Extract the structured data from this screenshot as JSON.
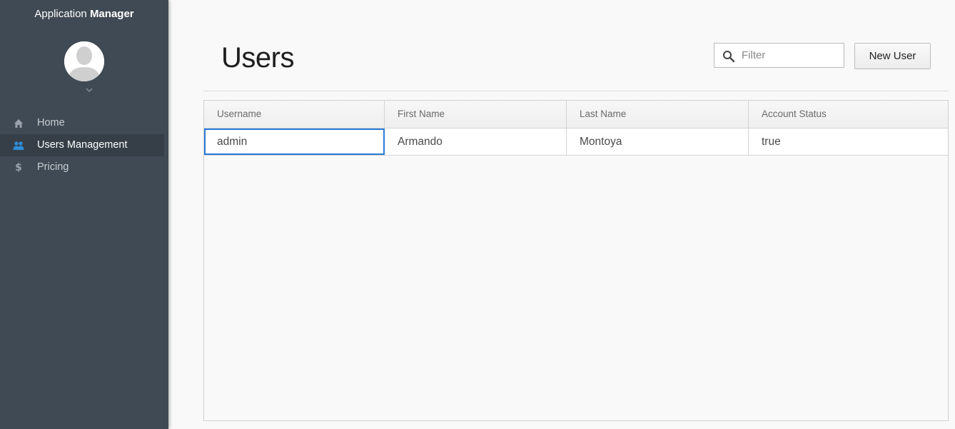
{
  "app": {
    "title_regular": "Application ",
    "title_bold": "Manager"
  },
  "sidebar": {
    "items": [
      {
        "label": "Home",
        "icon": "home-icon",
        "active": false
      },
      {
        "label": "Users Management",
        "icon": "users-icon",
        "active": true
      },
      {
        "label": "Pricing",
        "icon": "dollar-icon",
        "active": false
      }
    ]
  },
  "main": {
    "title": "Users",
    "filter": {
      "placeholder": "Filter",
      "value": ""
    },
    "new_user_label": "New User"
  },
  "grid": {
    "columns": [
      "Username",
      "First Name",
      "Last Name",
      "Account Status"
    ],
    "rows": [
      [
        "admin",
        "Armando",
        "Montoya",
        "true"
      ]
    ]
  },
  "colors": {
    "sidebar_bg": "#404a54",
    "active_item_bg": "#363f48",
    "accent": "#2f8ed8",
    "focus_border": "#2b7bd6"
  }
}
